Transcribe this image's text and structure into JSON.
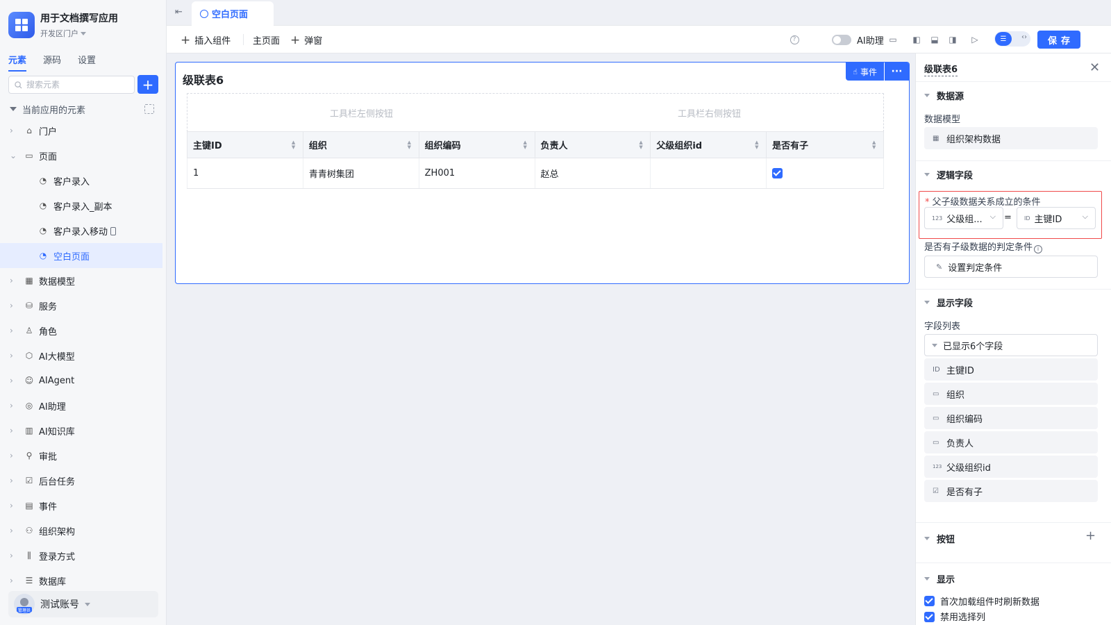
{
  "app": {
    "name": "用于文档撰写应用",
    "env": "开发区门户"
  },
  "side_tabs": [
    "元素",
    "源码",
    "设置"
  ],
  "search": {
    "placeholder": "搜索元素"
  },
  "tree_root": "当前应用的元素",
  "tree": [
    {
      "label": "门户",
      "icon": "home-icon"
    },
    {
      "label": "页面",
      "icon": "page-icon"
    },
    {
      "label": "客户录入",
      "icon": "page-item-icon"
    },
    {
      "label": "客户录入_副本",
      "icon": "page-item-icon"
    },
    {
      "label": "客户录入移动",
      "icon": "page-item-icon"
    },
    {
      "label": "空白页面",
      "icon": "page-item-icon"
    },
    {
      "label": "数据模型",
      "icon": "table-icon"
    },
    {
      "label": "服务",
      "icon": "service-icon"
    },
    {
      "label": "角色",
      "icon": "role-icon"
    },
    {
      "label": "AI大模型",
      "icon": "cube-icon"
    },
    {
      "label": "AIAgent",
      "icon": "robot-icon"
    },
    {
      "label": "AI助理",
      "icon": "ai-icon"
    },
    {
      "label": "AI知识库",
      "icon": "book-icon"
    },
    {
      "label": "审批",
      "icon": "stamp-icon"
    },
    {
      "label": "后台任务",
      "icon": "task-icon"
    },
    {
      "label": "事件",
      "icon": "event-icon"
    },
    {
      "label": "组织架构",
      "icon": "org-icon"
    },
    {
      "label": "登录方式",
      "icon": "login-icon"
    },
    {
      "label": "数据库",
      "icon": "database-icon"
    }
  ],
  "account": {
    "name": "测试账号",
    "role": "管理员"
  },
  "topbar": {
    "page_tab": "空白页面"
  },
  "toolbar": {
    "insert": "插入组件",
    "main_page": "主页面",
    "popup": "弹窗",
    "ai_assistant": "AI助理",
    "save": "保存"
  },
  "widget": {
    "title": "级联表6",
    "event_btn": "事件",
    "toolbar_left": "工具栏左侧按钮",
    "toolbar_right": "工具栏右侧按钮",
    "columns": [
      "主键ID",
      "组织",
      "组织编码",
      "负责人",
      "父级组织id",
      "是否有子"
    ],
    "rows": [
      {
        "id": "1",
        "org": "青青树集团",
        "code": "ZH001",
        "owner": "赵总",
        "parent": "",
        "has_child": true
      }
    ]
  },
  "panel": {
    "title": "级联表6",
    "datasource": {
      "head": "数据源",
      "label": "数据模型",
      "value": "组织架构数据"
    },
    "logic": {
      "head": "逻辑字段",
      "cond_label": "父子级数据关系成立的条件",
      "left_field": "父级组...",
      "eq": "=",
      "right_field": "主键ID",
      "child_label": "是否有子级数据的判定条件",
      "child_btn": "设置判定条件"
    },
    "display_fields": {
      "head": "显示字段",
      "list_label": "字段列表",
      "shown": "已显示6个字段",
      "fields": [
        "主键ID",
        "组织",
        "组织编码",
        "负责人",
        "父级组织id",
        "是否有子"
      ]
    },
    "buttons_head": "按钮",
    "display_head": "显示",
    "refresh_on_load": "首次加载组件时刷新数据",
    "next_option": "禁用选择列"
  }
}
